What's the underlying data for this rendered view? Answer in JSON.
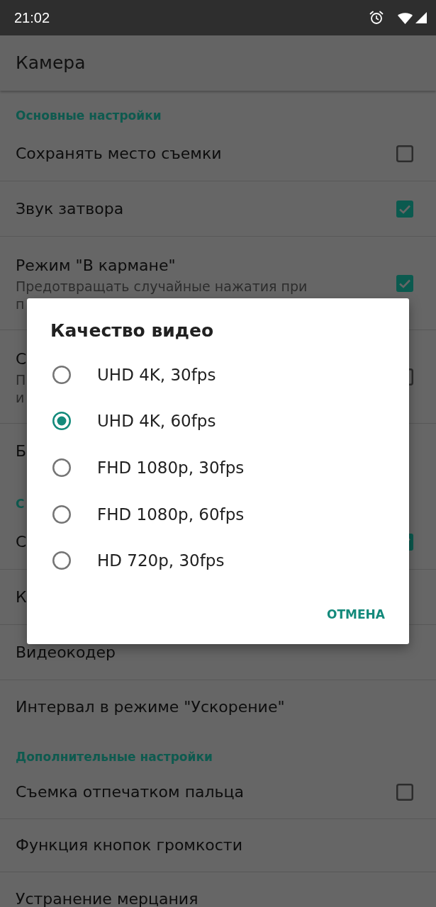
{
  "status_bar": {
    "time": "21:02"
  },
  "app_bar": {
    "title": "Камера"
  },
  "settings": [
    {
      "kind": "category",
      "title": "Основные настройки"
    },
    {
      "kind": "checkbox",
      "title": "Сохранять место съемки",
      "checked": false
    },
    {
      "kind": "checkbox",
      "title": "Звук затвора",
      "checked": true
    },
    {
      "kind": "checkbox",
      "title": "Режим \"В кармане\"",
      "summary_lines": [
        "Предотвращать случайные нажатия при",
        "п"
      ],
      "checked": true
    },
    {
      "kind": "checkbox",
      "title": "С",
      "summary_lines": [
        "П",
        "и"
      ],
      "checked": false
    },
    {
      "kind": "plain",
      "title": "Б"
    },
    {
      "kind": "category",
      "title": "С"
    },
    {
      "kind": "checkbox",
      "title": "С",
      "checked": true
    },
    {
      "kind": "plain",
      "title": "К"
    },
    {
      "kind": "plain",
      "title": "Видеокодер"
    },
    {
      "kind": "plain",
      "title": "Интервал в режиме \"Ускорение\""
    },
    {
      "kind": "category",
      "title": "Дополнительные настройки"
    },
    {
      "kind": "checkbox",
      "title": "Съемка отпечатком пальца",
      "checked": false
    },
    {
      "kind": "plain",
      "title": "Функция кнопок громкости"
    },
    {
      "kind": "plain",
      "title": "Устранение мерцания"
    }
  ],
  "dialog": {
    "title": "Качество видео",
    "options": [
      {
        "label": "UHD 4K, 30fps",
        "selected": false
      },
      {
        "label": "UHD 4K, 60fps",
        "selected": true
      },
      {
        "label": "FHD 1080p, 30fps",
        "selected": false
      },
      {
        "label": "FHD 1080p, 60fps",
        "selected": false
      },
      {
        "label": "HD 720p, 30fps",
        "selected": false
      }
    ],
    "buttons": [
      "ОТМЕНА"
    ]
  }
}
